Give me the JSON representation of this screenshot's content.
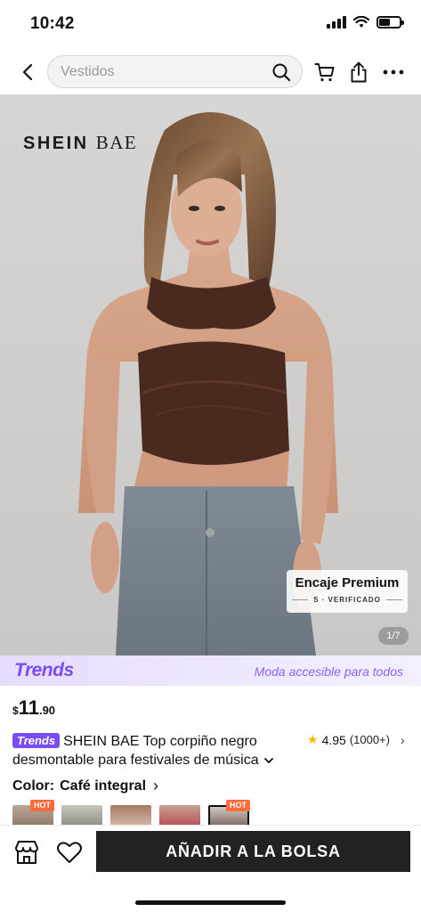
{
  "status_bar": {
    "time": "10:42"
  },
  "nav": {
    "search_placeholder": "Vestidos"
  },
  "product_image": {
    "brand_logo_main": "SHEIN",
    "brand_logo_sub": "BAE",
    "badge_title": "Encaje Premium",
    "badge_subtitle": "S · VERIFICADO",
    "page_indicator": "1/7"
  },
  "trends_banner": {
    "logo": "Trends",
    "tagline": "Moda accesible para todos"
  },
  "price": {
    "currency": "$",
    "integer": "11",
    "decimal": ".90"
  },
  "product": {
    "trends_chip": "Trends",
    "title": "SHEIN BAE Top corpiño negro desmontable para festivales de música",
    "rating": "4.95",
    "rating_count": "(1000+)"
  },
  "color": {
    "label": "Color:",
    "selected_value": "Café integral",
    "hot_label": "HOT"
  },
  "bottom_bar": {
    "add_to_bag": "AÑADIR A LA BOLSA"
  },
  "colors": {
    "accent_purple": "#7a4cf3",
    "hot_orange": "#ff6a3d",
    "button_dark": "#222222",
    "star": "#f5b800"
  }
}
